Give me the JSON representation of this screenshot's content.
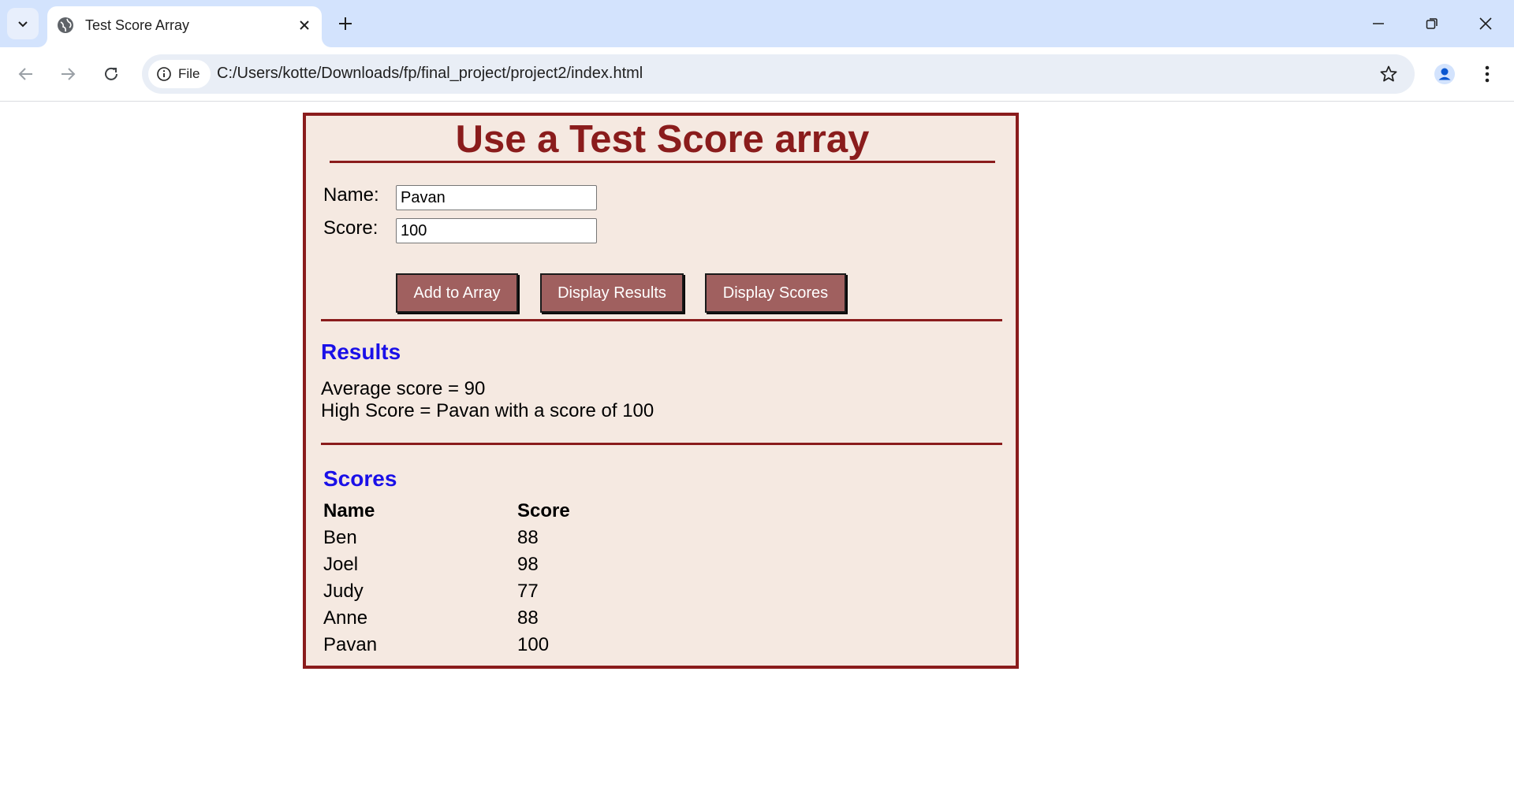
{
  "browser": {
    "tab_title": "Test Score Array",
    "site_chip": "File",
    "url": "C:/Users/kotte/Downloads/fp/final_project/project2/index.html"
  },
  "page": {
    "heading": "Use a Test Score array",
    "form": {
      "name_label": "Name:",
      "name_value": "Pavan",
      "score_label": "Score:",
      "score_value": "100"
    },
    "buttons": {
      "add": "Add to Array",
      "display_results": "Display Results",
      "display_scores": "Display Scores"
    },
    "results": {
      "heading": "Results",
      "average": "Average score = 90",
      "high": "High Score = Pavan with a score of 100"
    },
    "scores": {
      "heading": "Scores",
      "columns": [
        "Name",
        "Score"
      ],
      "rows": [
        [
          "Ben",
          "88"
        ],
        [
          "Joel",
          "98"
        ],
        [
          "Judy",
          "77"
        ],
        [
          "Anne",
          "88"
        ],
        [
          "Pavan",
          "100"
        ]
      ]
    }
  },
  "colors": {
    "brand_dark_red": "#8a1c1c",
    "panel_bg": "#f5e9e1",
    "button_bg": "#a0605f",
    "subheading_blue": "#1a10e8"
  }
}
